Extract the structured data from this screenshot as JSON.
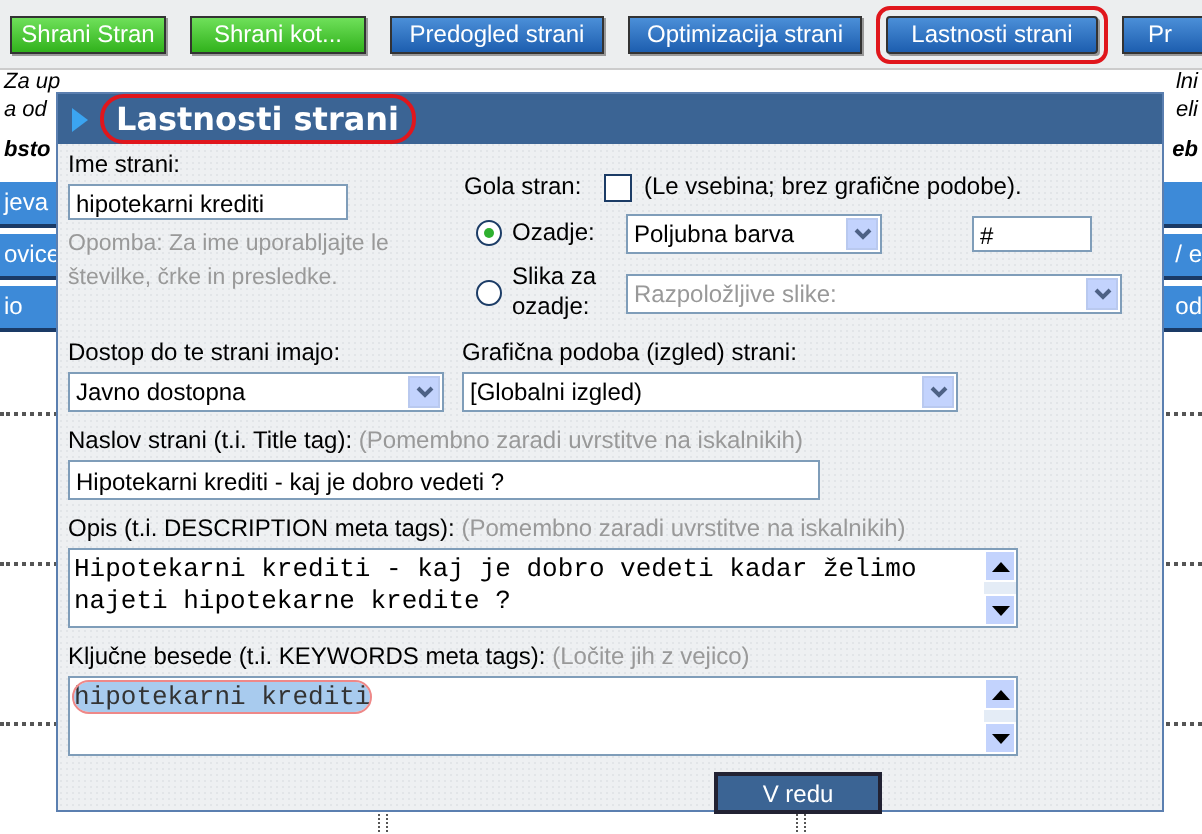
{
  "toolbar": [
    {
      "label": "Shrani Stran",
      "kind": "save",
      "circled": false
    },
    {
      "label": "Shrani kot...",
      "kind": "save",
      "circled": false
    },
    {
      "label": "Predogled strani",
      "kind": "action",
      "circled": false
    },
    {
      "label": "Optimizacija strani",
      "kind": "action",
      "circled": false
    },
    {
      "label": "Lastnosti strani",
      "kind": "action",
      "circled": true
    },
    {
      "label": "Pr",
      "kind": "action",
      "circled": false
    }
  ],
  "background_page": {
    "left_lines": [
      "Za up",
      "a od"
    ],
    "right_lines": [
      "lni",
      "eli"
    ],
    "left_heading": "bsto",
    "right_heading": "eb",
    "left_buttons": [
      "jeva",
      "ovice",
      "io"
    ],
    "right_buttons": [
      "/ e",
      "od"
    ]
  },
  "dialog": {
    "title": "Lastnosti strani",
    "title_circled": true,
    "name": {
      "label": "Ime strani:",
      "value": "hipotekarni krediti",
      "note": "Opomba: Za ime uporabljajte le številke, črke in presledke."
    },
    "bare_page": {
      "label": "Gola stran:",
      "checked": false,
      "hint": "(Le vsebina; brez grafične podobe)."
    },
    "background_options": [
      {
        "label": "Ozadje:",
        "selected": true,
        "select": "Poljubna barva",
        "disabled": false,
        "color_value": "#"
      },
      {
        "label": "Slika za ozadje:",
        "selected": false,
        "select": "Razpoložljive slike:",
        "disabled": true
      }
    ],
    "access": {
      "label": "Dostop do te strani imajo:",
      "value": "Javno dostopna"
    },
    "design": {
      "label": "Grafična podoba (izgled) strani:",
      "value": "[Globalni izgled)"
    },
    "title_tag": {
      "label": "Naslov strani (t.i. Title tag):",
      "hint": "(Pomembno zaradi uvrstitve na iskalnikih)",
      "value": "Hipotekarni krediti - kaj je dobro vedeti ?"
    },
    "description": {
      "label": "Opis (t.i. DESCRIPTION meta tags):",
      "hint": "(Pomembno zaradi uvrstitve na iskalnikih)",
      "value": "Hipotekarni krediti - kaj je dobro vedeti kadar želimo najeti hipotekarne kredite ?",
      "text_selected": false,
      "circled": false
    },
    "keywords": {
      "label": "Ključne besede (t.i. KEYWORDS meta tags):",
      "hint": "(Ločite jih z vejico)",
      "value": "hipotekarni krediti",
      "text_selected": true,
      "circled": true
    },
    "ok_button": "V redu"
  }
}
